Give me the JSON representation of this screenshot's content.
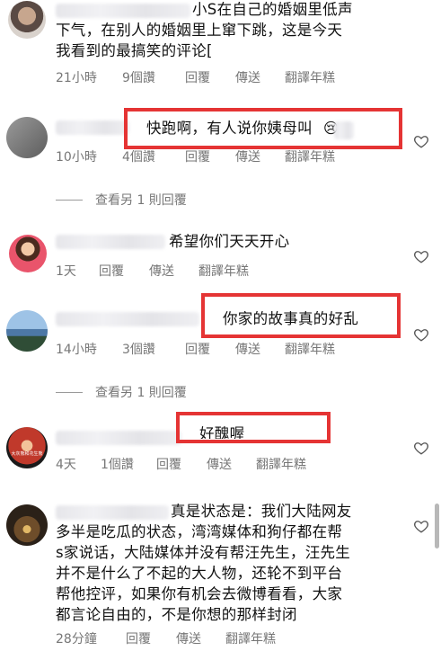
{
  "comments": [
    {
      "text_lines": [
        "小S在自己的婚姻里低声",
        "下气，在别人的婚姻里上窜下跳，这是今天",
        "我看到的最搞笑的评论["
      ],
      "time": "21小時",
      "likes": "9個讚",
      "reply": "回覆",
      "send": "傳送",
      "translate": "翻譯年糕"
    },
    {
      "text": "快跑啊，有人说你姨母叫",
      "emoji": "😢",
      "time": "10小時",
      "likes": "4個讚",
      "reply": "回覆",
      "send": "傳送",
      "translate": "翻譯年糕",
      "view_more": "查看另 1 則回覆"
    },
    {
      "text": "希望你们天天开心",
      "time": "1天",
      "reply": "回覆",
      "send": "傳送",
      "translate": "翻譯年糕"
    },
    {
      "text": "你家的故事真的好乱",
      "time": "14小時",
      "likes": "3個讚",
      "reply": "回覆",
      "send": "傳送",
      "translate": "翻譯年糕",
      "view_more": "查看另 1 則回覆"
    },
    {
      "text": "好醜喔",
      "avatar_caption": "大灰熊和花生熊",
      "time": "4天",
      "likes": "1個讚",
      "reply": "回覆",
      "send": "傳送",
      "translate": "翻譯年糕"
    },
    {
      "text_lines": [
        "真是状态是：我们大陆网友",
        "多半是吃瓜的状态，湾湾媒体和狗仔都在帮",
        "s家说话，大陆媒体并没有帮汪先生，汪先生",
        "并不是什么了不起的大人物，还轮不到平台",
        "帮他控评，如果你有机会去微博看看，大家",
        "都言论自由的，不是你想的那样封闭"
      ],
      "time": "28分鐘",
      "reply": "回覆",
      "send": "傳送",
      "translate": "翻譯年糕"
    }
  ],
  "colors": {
    "highlight": "#e53434",
    "meta_text": "#777777"
  }
}
